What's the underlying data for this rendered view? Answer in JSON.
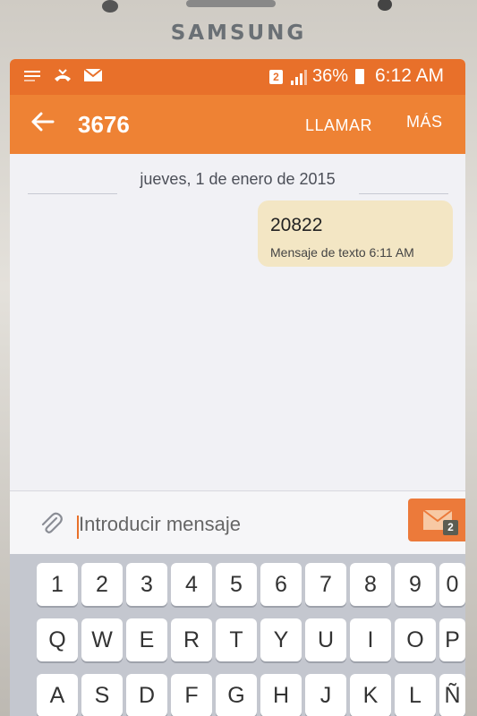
{
  "device": {
    "brand": "SAMSUNG"
  },
  "status_bar": {
    "sim_slot": "2",
    "battery": "36%",
    "time": "6:12 AM",
    "icons": [
      "menu-lines-icon",
      "missed-call-icon",
      "mail-icon",
      "signal-icon",
      "battery-icon"
    ]
  },
  "app_bar": {
    "contact": "3676",
    "call_label": "LLAMAR",
    "more_label": "MÁS",
    "back_icon": "back-arrow-icon"
  },
  "conversation": {
    "date": "jueves, 1 de enero de 2015",
    "messages": [
      {
        "text": "20822",
        "meta": "Mensaje de texto 6:11 AM"
      }
    ]
  },
  "input": {
    "placeholder": "Introducir mensaje",
    "value": "",
    "send_sim_badge": "2"
  },
  "colors": {
    "status_bar": "#e8702a",
    "app_bar": "#ee8234",
    "bubble": "#f3e6c4",
    "send_button": "#ec7a3a"
  },
  "keyboard": {
    "row1": [
      "1",
      "2",
      "3",
      "4",
      "5",
      "6",
      "7",
      "8",
      "9",
      "0"
    ],
    "row2": [
      "Q",
      "W",
      "E",
      "R",
      "T",
      "Y",
      "U",
      "I",
      "O",
      "P"
    ],
    "row3": [
      "A",
      "S",
      "D",
      "F",
      "G",
      "H",
      "J",
      "K",
      "L",
      "Ñ"
    ]
  }
}
